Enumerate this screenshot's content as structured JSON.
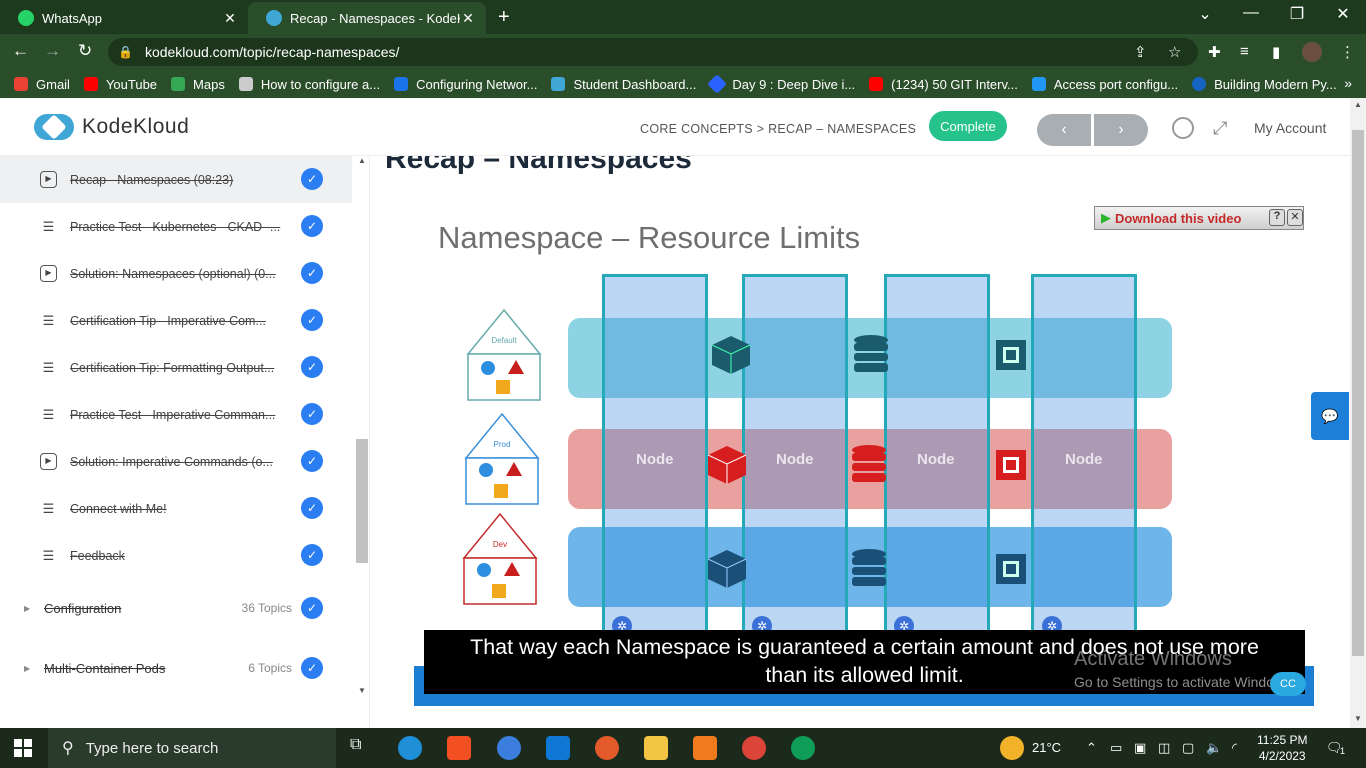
{
  "browser": {
    "tabs": [
      {
        "title": "WhatsApp",
        "favicon_color": "#25d366"
      },
      {
        "title": "Recap - Namespaces - KodeKloud",
        "favicon_color": "#3fa6d6"
      }
    ],
    "url": "kodekloud.com/topic/recap-namespaces/",
    "bookmarks": [
      {
        "label": "Gmail",
        "color": "#ea4335"
      },
      {
        "label": "YouTube",
        "color": "#ff0000"
      },
      {
        "label": "Maps",
        "color": "#34a853"
      },
      {
        "label": "How to configure a...",
        "color": "#cccccc"
      },
      {
        "label": "Configuring Networ...",
        "color": "#1a73e8"
      },
      {
        "label": "Student Dashboard...",
        "color": "#3fa6d6"
      },
      {
        "label": "Day 9 : Deep Dive i...",
        "color": "#2962ff"
      },
      {
        "label": "(1234) 50 GIT Interv...",
        "color": "#ff0000"
      },
      {
        "label": "Access port configu...",
        "color": "#2196f3"
      },
      {
        "label": "Building Modern Py...",
        "color": "#1565c0"
      }
    ]
  },
  "header": {
    "logo_text": "KodeKloud",
    "breadcrumb": "CORE CONCEPTS > RECAP – NAMESPACES",
    "complete_label": "Complete",
    "prev_label": "‹",
    "next_label": "›",
    "account_label": "My Account"
  },
  "sidebar": {
    "lessons": [
      {
        "label": "Recap - Namespaces (08:23)",
        "type": "video"
      },
      {
        "label": "Practice Test - Kubernetes - CKAD -...",
        "type": "text"
      },
      {
        "label": "Solution: Namespaces (optional) (0...",
        "type": "video"
      },
      {
        "label": "Certification Tip - Imperative Com...",
        "type": "text"
      },
      {
        "label": "Certification Tip: Formatting Output...",
        "type": "text"
      },
      {
        "label": "Practice Test - Imperative Comman...",
        "type": "text"
      },
      {
        "label": "Solution: Imperative Commands (o...",
        "type": "video"
      },
      {
        "label": "Connect with Me!",
        "type": "text"
      },
      {
        "label": "Feedback",
        "type": "text"
      }
    ],
    "sections": [
      {
        "label": "Configuration",
        "count": "36 Topics"
      },
      {
        "label": "Multi-Container Pods",
        "count": "6 Topics"
      }
    ]
  },
  "main": {
    "title": "Recap – Namespaces",
    "video": {
      "slide_title": "Namespace – Resource Limits",
      "download_label": "Download this video",
      "namespaces": [
        "Default",
        "Prod",
        "Dev"
      ],
      "node_label": "Node",
      "caption_line1": "That way each Namespace is guaranteed a certain amount and does not use more",
      "caption_line2": "than its allowed limit.",
      "watermark_title": "Activate Windows",
      "watermark_sub": "Go to Settings to activate Windows."
    }
  },
  "taskbar": {
    "search_placeholder": "Type here to search",
    "weather": "21°C",
    "time": "11:25 PM",
    "date": "4/2/2023",
    "notifications": "1"
  },
  "colors": {
    "complete": "#25c38b",
    "check": "#2a7ef2",
    "accent": "#1e7fd9"
  }
}
